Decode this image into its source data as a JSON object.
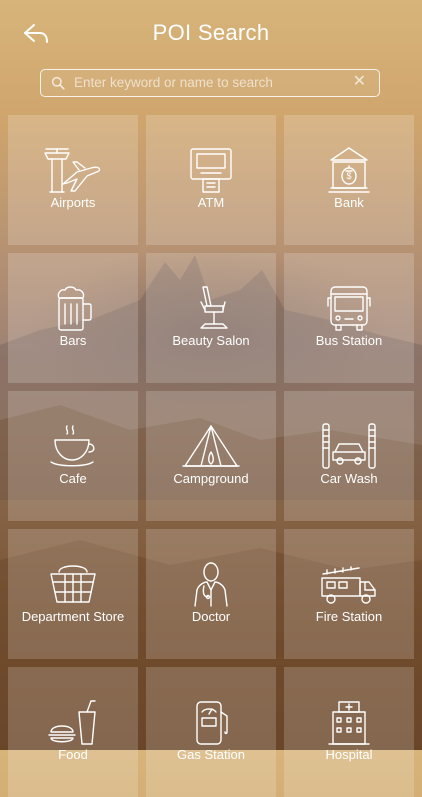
{
  "header": {
    "title": "POI Search"
  },
  "search": {
    "placeholder": "Enter keyword or name to search",
    "value": ""
  },
  "tiles": [
    {
      "label": "Airports",
      "icon": "airport-icon"
    },
    {
      "label": "ATM",
      "icon": "atm-icon"
    },
    {
      "label": "Bank",
      "icon": "bank-icon"
    },
    {
      "label": "Bars",
      "icon": "beer-mug-icon"
    },
    {
      "label": "Beauty Salon",
      "icon": "salon-chair-icon"
    },
    {
      "label": "Bus Station",
      "icon": "bus-icon"
    },
    {
      "label": "Cafe",
      "icon": "coffee-cup-icon"
    },
    {
      "label": "Campground",
      "icon": "tent-icon"
    },
    {
      "label": "Car Wash",
      "icon": "car-wash-icon"
    },
    {
      "label": "Department Store",
      "icon": "shopping-basket-icon"
    },
    {
      "label": "Doctor",
      "icon": "doctor-icon"
    },
    {
      "label": "Fire Station",
      "icon": "fire-truck-icon"
    },
    {
      "label": "Food",
      "icon": "food-icon"
    },
    {
      "label": "Gas Station",
      "icon": "gas-pump-icon"
    },
    {
      "label": "Hospital",
      "icon": "hospital-icon"
    }
  ]
}
